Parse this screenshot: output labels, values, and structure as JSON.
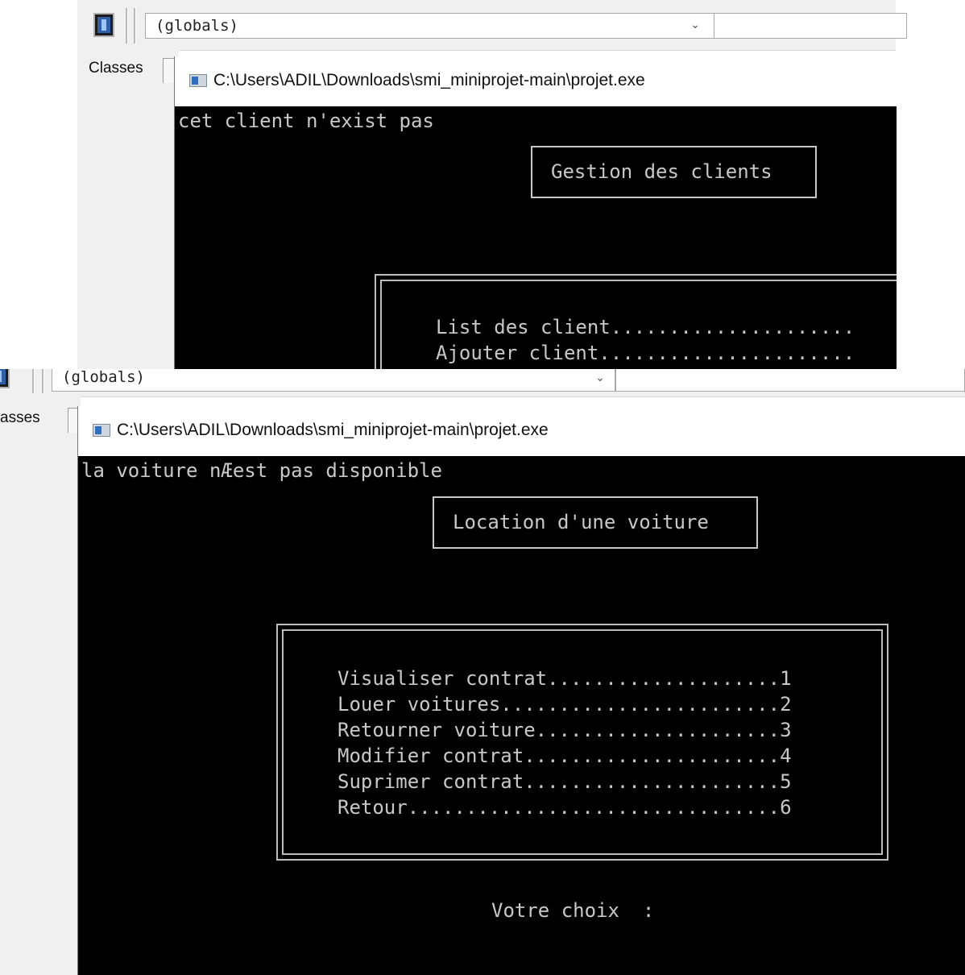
{
  "shot1": {
    "ide": {
      "combo_value": "(globals)",
      "tab_label": "Classes"
    },
    "console": {
      "title": "C:\\Users\\ADIL\\Downloads\\smi_miniprojet-main\\projet.exe",
      "message": "cet client n'exist pas",
      "header": "Gestion des clients",
      "menu": [
        "List des client.....................",
        "Ajouter client......................"
      ]
    }
  },
  "shot2": {
    "ide": {
      "combo_value": "(globals)",
      "tab_label": "asses"
    },
    "console": {
      "title": "C:\\Users\\ADIL\\Downloads\\smi_miniprojet-main\\projet.exe",
      "message": "la voiture nÆest pas disponible",
      "header": "Location d'une voiture",
      "menu": [
        "Visualiser contrat....................1",
        "Louer voitures........................2",
        "Retourner voiture.....................3",
        "Modifier contrat......................4",
        "Suprimer contrat......................5",
        "Retour................................6"
      ],
      "prompt": "Votre choix  :"
    }
  }
}
